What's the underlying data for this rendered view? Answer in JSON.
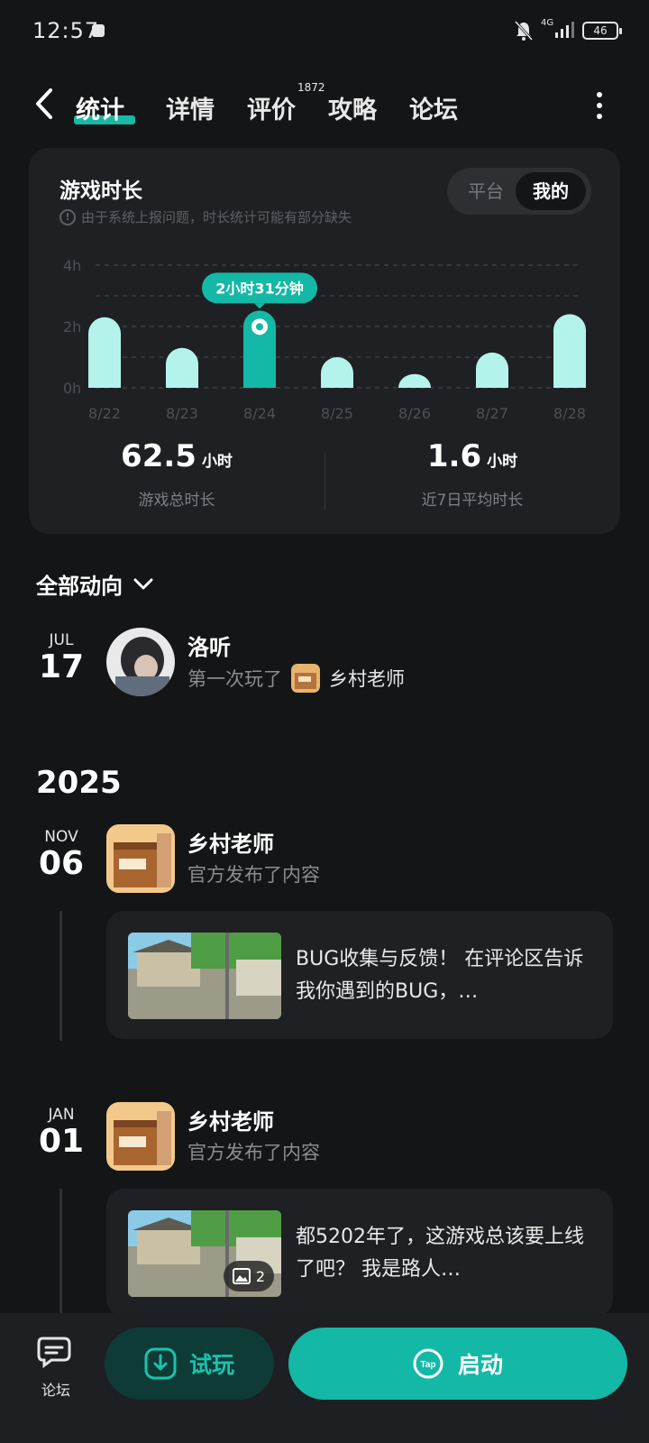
{
  "status": {
    "time": "12:57",
    "network": "4G",
    "battery": "46"
  },
  "nav": {
    "tabs": [
      {
        "label": "统计"
      },
      {
        "label": "详情"
      },
      {
        "label": "评价"
      },
      {
        "label": "攻略"
      },
      {
        "label": "论坛"
      }
    ],
    "review_count": "1872"
  },
  "stats": {
    "title": "游戏时长",
    "note": "由于系统上报问题，时长统计可能有部分缺失",
    "toggle": [
      "平台",
      "我的"
    ],
    "total_value": "62.5",
    "total_unit": "小时",
    "total_label": "游戏总时长",
    "avg_value": "1.6",
    "avg_unit": "小时",
    "avg_label": "近7日平均时长"
  },
  "chart_data": {
    "type": "bar",
    "categories": [
      "8/22",
      "8/23",
      "8/24",
      "8/25",
      "8/26",
      "8/27",
      "8/28"
    ],
    "values": [
      2.3,
      1.3,
      2.52,
      1.0,
      0.45,
      1.15,
      2.4
    ],
    "y_tick_labels": [
      "4h",
      "2h",
      "0h"
    ],
    "ylim": [
      0,
      4
    ],
    "highlight_index": 2,
    "highlight_label": "2小时31分钟",
    "bar_color": "#b4f3ec",
    "highlight_color": "#14b8a6"
  },
  "activity": {
    "header": "全部动向",
    "entries": [
      {
        "month": "JUL",
        "day": "17",
        "name": "洛听",
        "action": "第一次玩了",
        "game": "乡村老师"
      }
    ],
    "year": "2025",
    "posts": [
      {
        "month": "NOV",
        "day": "06",
        "name": "乡村老师",
        "action": "官方发布了内容",
        "text": "BUG收集与反馈！ 在评论区告诉我你遇到的BUG，…"
      },
      {
        "month": "JAN",
        "day": "01",
        "name": "乡村老师",
        "action": "官方发布了内容",
        "text": "都5202年了，这游戏总该要上线了吧？ 我是路人…",
        "image_count": "2"
      }
    ]
  },
  "bottom": {
    "forum": "论坛",
    "try": "试玩",
    "start": "启动",
    "tap_logo": "Tap"
  },
  "colors": {
    "accent": "#14b8a6",
    "bg": "#141516",
    "card": "#1f2023"
  }
}
